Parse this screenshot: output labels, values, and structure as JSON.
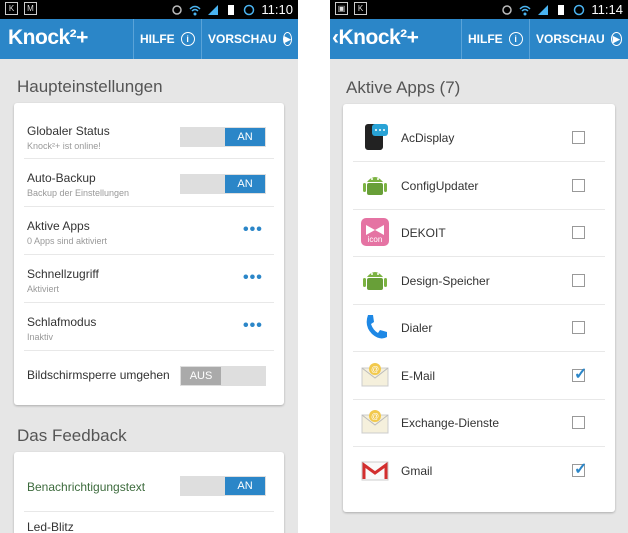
{
  "left": {
    "status": {
      "time": "11:10"
    },
    "actionbar": {
      "logo": "Knock²+",
      "help": "HILFE",
      "preview": "VORSCHAU"
    },
    "sections": [
      {
        "title": "Haupteinstellungen"
      },
      {
        "title": "Das Feedback"
      }
    ],
    "main_rows": [
      {
        "title": "Globaler Status",
        "subtitle": "Knock²+ ist online!",
        "control": "toggle",
        "value": "AN"
      },
      {
        "title": "Auto-Backup",
        "subtitle": "Backup der Einstellungen",
        "control": "toggle",
        "value": "AN"
      },
      {
        "title": "Aktive Apps",
        "subtitle": "0 Apps sind aktiviert",
        "control": "more"
      },
      {
        "title": "Schnellzugriff",
        "subtitle": "Aktiviert",
        "control": "more"
      },
      {
        "title": "Schlafmodus",
        "subtitle": "Inaktiv",
        "control": "more"
      },
      {
        "title": "Bildschirmsperre umgehen",
        "subtitle": "",
        "control": "toggle",
        "value": "AUS"
      }
    ],
    "feedback_rows": [
      {
        "title": "Benachrichtigungstext",
        "control": "toggle",
        "value": "AN"
      },
      {
        "title": "Led-Blitz"
      }
    ]
  },
  "right": {
    "status": {
      "time": "11:14"
    },
    "actionbar": {
      "logo": "Knock²+",
      "help": "HILFE",
      "preview": "VORSCHAU"
    },
    "section_title": "Aktive Apps (7)",
    "apps": [
      {
        "name": "AcDisplay",
        "checked": false,
        "icon": "acdisplay-icon"
      },
      {
        "name": "ConfigUpdater",
        "checked": false,
        "icon": "android-icon"
      },
      {
        "name": "DEKOIT",
        "checked": false,
        "icon": "dekoit-icon",
        "icon_text": "icon"
      },
      {
        "name": "Design-Speicher",
        "checked": false,
        "icon": "android-icon"
      },
      {
        "name": "Dialer",
        "checked": false,
        "icon": "phone-icon"
      },
      {
        "name": "E-Mail",
        "checked": true,
        "icon": "email-icon"
      },
      {
        "name": "Exchange-Dienste",
        "checked": false,
        "icon": "email-icon"
      },
      {
        "name": "Gmail",
        "checked": true,
        "icon": "gmail-icon"
      }
    ]
  },
  "colors": {
    "accent": "#2b86c8",
    "toggle_off": "#aaaaaa",
    "background": "#e6e6e6"
  }
}
